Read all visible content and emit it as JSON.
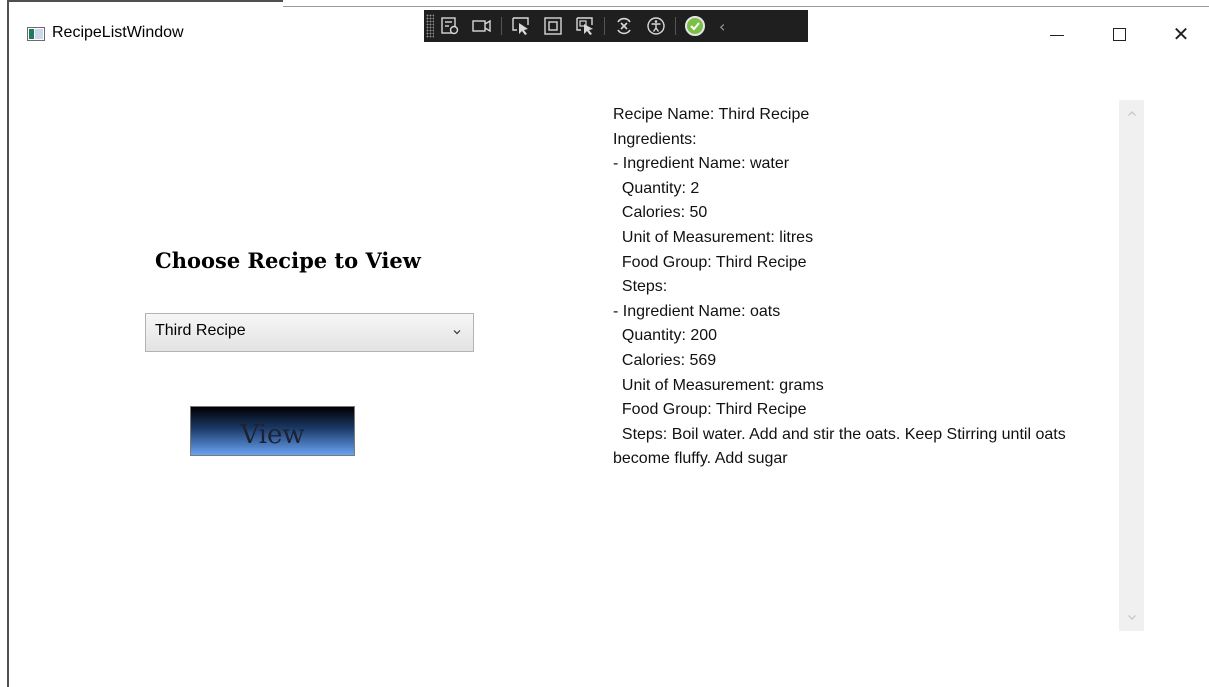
{
  "window": {
    "title": "RecipeListWindow",
    "close_glyph": "✕"
  },
  "debug_toolbar": {
    "icons": [
      "live-visual-tree-icon",
      "record-icon",
      "select-element-icon",
      "display-layout-adorners-icon",
      "track-focus-icon",
      "hot-reload-icon",
      "accessibility-icon",
      "binding-ok-icon"
    ],
    "collapse_glyph": "‹"
  },
  "left_panel": {
    "heading": "Choose Recipe to View",
    "recipe_select": {
      "value": "Third Recipe"
    },
    "view_button": "View"
  },
  "recipe_details": {
    "lines": [
      "Recipe Name: Third Recipe",
      "Ingredients:",
      "- Ingredient Name: water",
      "  Quantity: 2",
      "  Calories: 50",
      "  Unit of Measurement: litres",
      "  Food Group: Third Recipe",
      "  Steps:",
      "- Ingredient Name: oats",
      "  Quantity: 200",
      "  Calories: 569",
      "  Unit of Measurement: grams",
      "  Food Group: Third Recipe"
    ],
    "steps_text": "  Steps: Boil water. Add and stir the oats. Keep Stirring until oats become fluffy. Add sugar"
  },
  "colors": {
    "toolbar_bg": "#1f1f1f",
    "check_green": "#7ac046",
    "button_gradient_top": "#000000",
    "button_gradient_bottom": "#6aa3f2",
    "scrollbar_track": "#f0f0f0"
  }
}
